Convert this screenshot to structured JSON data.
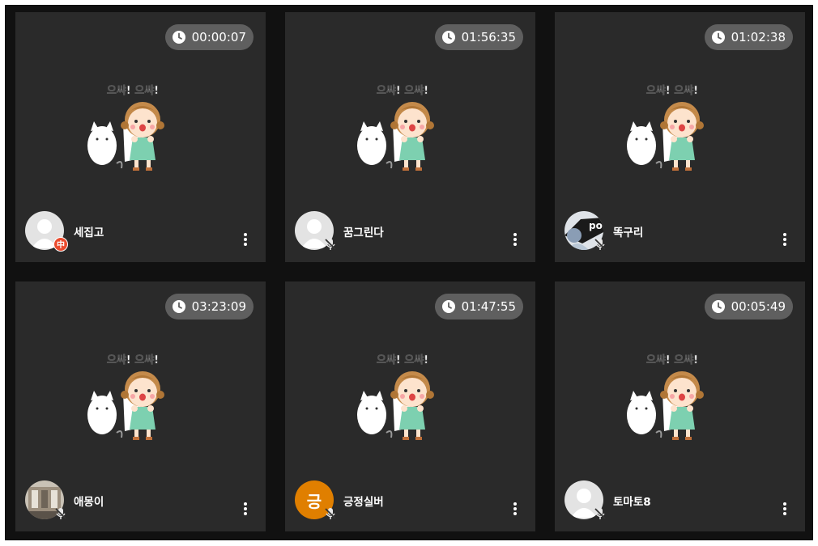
{
  "tiles": [
    {
      "time": "00:00:07",
      "name": "세집고",
      "avatar": "default",
      "status": "live",
      "live_label": "中"
    },
    {
      "time": "01:56:35",
      "name": "꿈그린다",
      "avatar": "default",
      "status": "mic-off"
    },
    {
      "time": "01:02:38",
      "name": "똑구리",
      "avatar": "photo-cap",
      "status": "mic-off"
    },
    {
      "time": "03:23:09",
      "name": "애몽이",
      "avatar": "photo-room",
      "status": "mic-off"
    },
    {
      "time": "01:47:55",
      "name": "긍정실버",
      "avatar": "initial",
      "avatar_initial": "긍",
      "status": "mic-off"
    },
    {
      "time": "00:05:49",
      "name": "토마토8",
      "avatar": "default",
      "status": "mic-off"
    }
  ],
  "sticker": {
    "caption": "으쌰! 으쌰!"
  },
  "icons": {
    "timer": "clock-icon",
    "menu": "more-vertical-icon",
    "muted": "mic-off-icon"
  },
  "colors": {
    "tile_bg": "#2a2a2a",
    "timer_pill": "#5f5f5f",
    "live_badge": "#ea4b2e",
    "initial_avatar": "#e07f00"
  }
}
